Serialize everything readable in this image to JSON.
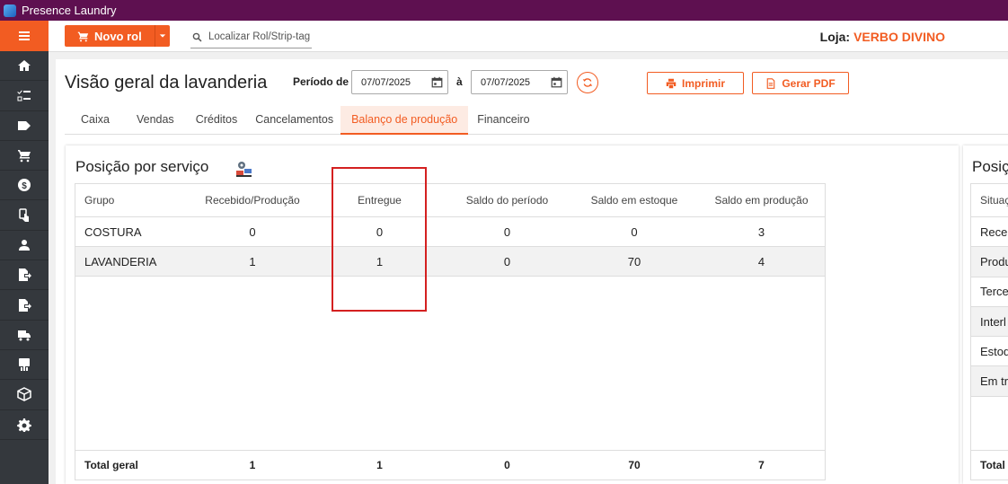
{
  "window": {
    "title": "Presence Laundry"
  },
  "topbar": {
    "novo_rol_label": "Novo rol",
    "search_placeholder": "Localizar Rol/Strip-tag",
    "loja_label": "Loja:",
    "loja_value": "VERBO DIVINO"
  },
  "header": {
    "title": "Visão geral da lavanderia",
    "periodo_label": "Período de",
    "date_from": "07/07/2025",
    "a_label": "à",
    "date_to": "07/07/2025",
    "print_label": "Imprimir",
    "pdf_label": "Gerar PDF"
  },
  "tabs": [
    {
      "label": "Caixa"
    },
    {
      "label": "Vendas"
    },
    {
      "label": "Créditos"
    },
    {
      "label": "Cancelamentos"
    },
    {
      "label": "Balanço de produção",
      "active": true
    },
    {
      "label": "Financeiro"
    }
  ],
  "service_panel": {
    "title": "Posição por serviço",
    "columns": [
      "Grupo",
      "Recebido/Produção",
      "Entregue",
      "Saldo do período",
      "Saldo em estoque",
      "Saldo em produção"
    ],
    "rows": [
      [
        "COSTURA",
        "0",
        "0",
        "0",
        "0",
        "3"
      ],
      [
        "LAVANDERIA",
        "1",
        "1",
        "0",
        "70",
        "4"
      ]
    ],
    "total": [
      "Total geral",
      "1",
      "1",
      "0",
      "70",
      "7"
    ]
  },
  "side_panel": {
    "title": "Posiç",
    "header": "Situaç",
    "rows": [
      "Receb",
      "Produ",
      "Terce",
      "Interl",
      "Estoq",
      "Em tr"
    ],
    "total": "Total g"
  },
  "sidebar_icons": [
    "home-icon",
    "checklist-icon",
    "tag-icon",
    "cart-icon",
    "money-icon",
    "touch-icon",
    "user-icon",
    "export-doc-icon",
    "export-doc-icon",
    "truck-icon",
    "machine-icon",
    "box-icon",
    "gear-icon"
  ],
  "colors": {
    "accent": "#f25c22",
    "titlebar": "#5e1050",
    "sidebar": "#34383d",
    "highlight": "#d42020"
  }
}
